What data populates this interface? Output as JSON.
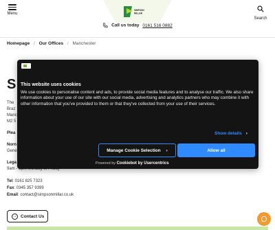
{
  "header": {
    "menu_label": "Menu",
    "search_label": "Search",
    "logo_text": "SIMPSON MILLAR"
  },
  "call_bar": {
    "label": "Call us today",
    "number": "0161 516 0882"
  },
  "breadcrumb": {
    "items": [
      "Homepage",
      "Our Offices"
    ],
    "current": "Manchester"
  },
  "page": {
    "title_fragment": "S",
    "lines": {
      "l1": "The",
      "l2": "Braz",
      "l3": "Manc",
      "l4": "M2 5",
      "please": "Plea",
      "normal_hours_label": "Norn",
      "normal_hours_value": "Gene",
      "legal_label": "Lega",
      "hours": "9am - 5pm Monday to Friday",
      "tel_label": "Tel",
      "tel_value": ": 0161 825 7323",
      "fax_label": "Fax",
      "fax_value": ": 0345 357 9399",
      "email_label": "Email",
      "email_value": ": contact@simpsonmillar.co.uk"
    },
    "contact_button": "Contact Us"
  },
  "cookie": {
    "title": "This website uses cookies",
    "text": "We use cookies to personalise content and ads, to provide social media features and to analyse our traffic. We also share information about your use of our site with our social media, advertising and analytics partners who may combine it with other information that you've provided to them or that they've collected from your use of their services.",
    "show_details": "Show details",
    "manage_button": "Manage Cookie Selection",
    "allow_button": "Allow all",
    "powered_prefix": "Powered by",
    "powered_brand": "Cookiebot by Usercentrics"
  },
  "colors": {
    "accent_blue": "#2f8bff",
    "dialog_bg": "#141414",
    "brand_green": "#6bbf3a",
    "chat_orange": "#f29a2e"
  }
}
